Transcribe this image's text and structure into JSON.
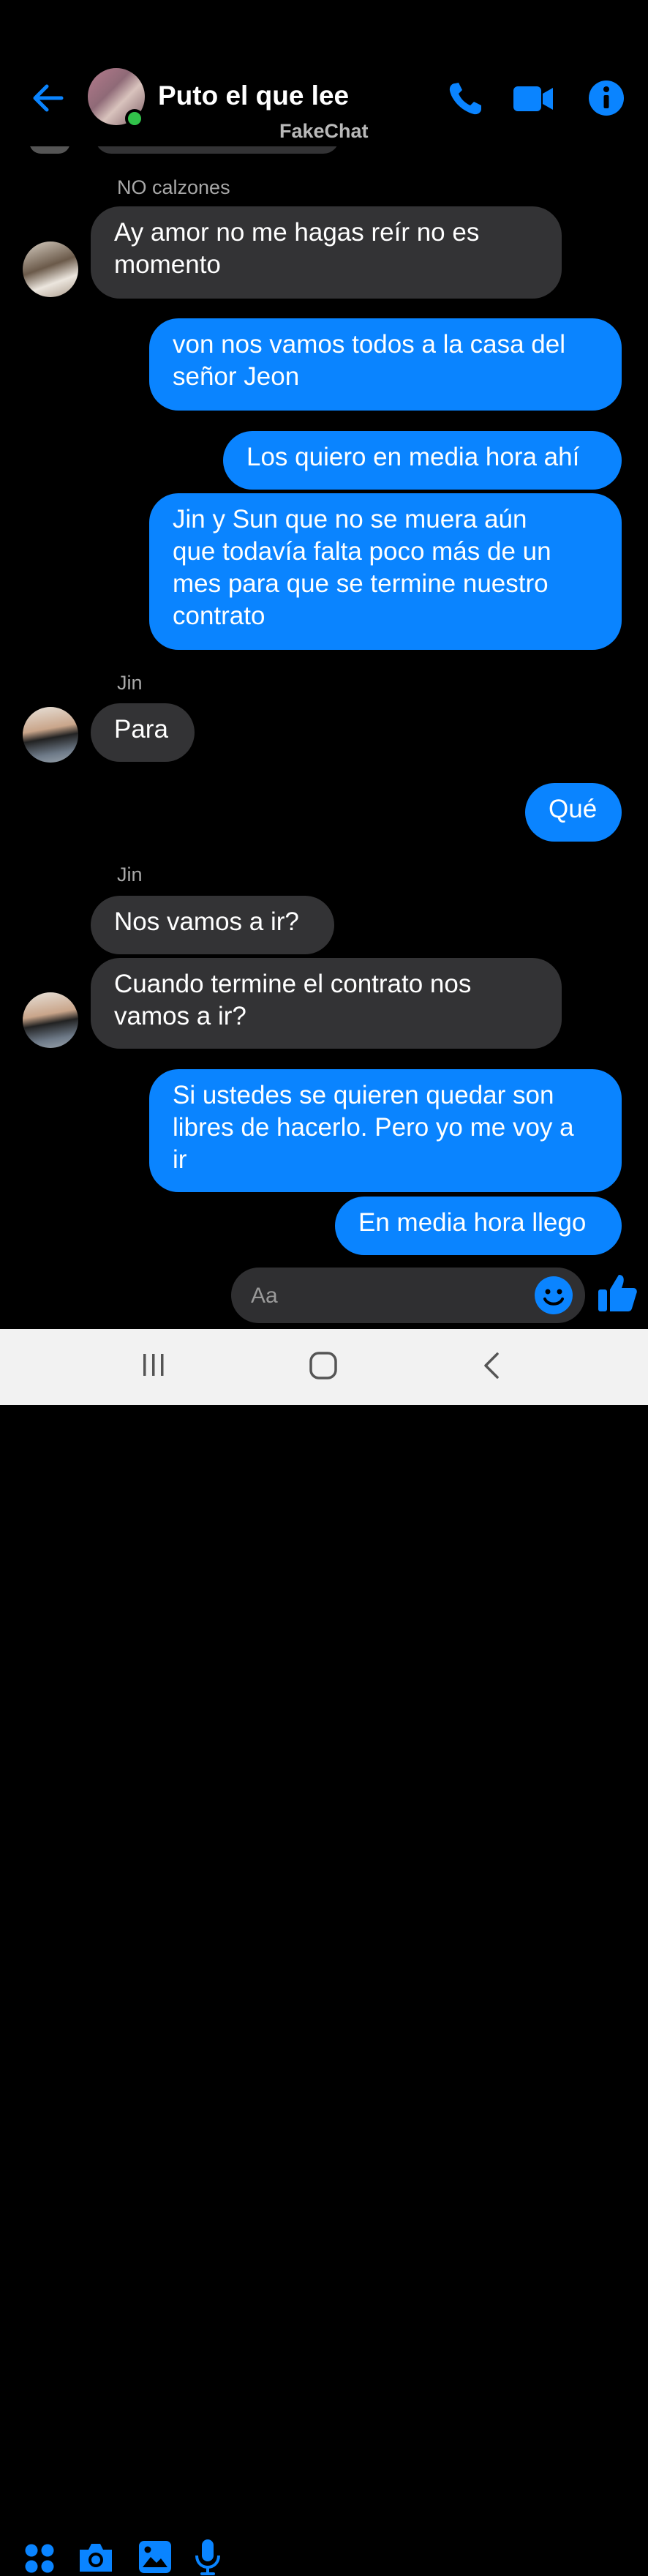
{
  "header": {
    "title": "Puto el que lee",
    "watermark": "FakeChat",
    "icons": [
      "back-arrow-icon",
      "phone-icon",
      "video-camera-icon",
      "info-icon"
    ]
  },
  "conversation": {
    "sender_label_1": "NO calzones",
    "msg_1": "Ay amor no me hagas reír no es\nmomento",
    "msg_2": "von nos vamos todos a la casa del\nseñor Jeon",
    "msg_3": "Los quiero en media hora ahí",
    "msg_4": "Jin y Sun que no se muera aún\nque todavía falta poco más de un\nmes para que se termine nuestro\ncontrato",
    "sender_label_2": "Jin",
    "msg_5": "Para",
    "msg_6": "Qué",
    "sender_label_3": "Jin",
    "msg_7": "Nos vamos a ir?",
    "msg_8": "Cuando termine el contrato nos\nvamos a ir?",
    "msg_9": "Si ustedes se quieren quedar son\nlibres de hacerlo. Pero yo me voy a\nir",
    "msg_10": "En media hora llego"
  },
  "composer": {
    "placeholder": "Aa",
    "icons": [
      "apps-grid-icon",
      "camera-icon",
      "image-icon",
      "microphone-icon",
      "emoji-icon",
      "thumbs-up-icon"
    ]
  },
  "navbar": {
    "icons": [
      "recents-icon",
      "home-icon",
      "back-icon"
    ]
  },
  "colors": {
    "accent": "#0a84ff",
    "incoming_bubble": "#333335",
    "background": "#000000",
    "online": "#31c24a"
  }
}
